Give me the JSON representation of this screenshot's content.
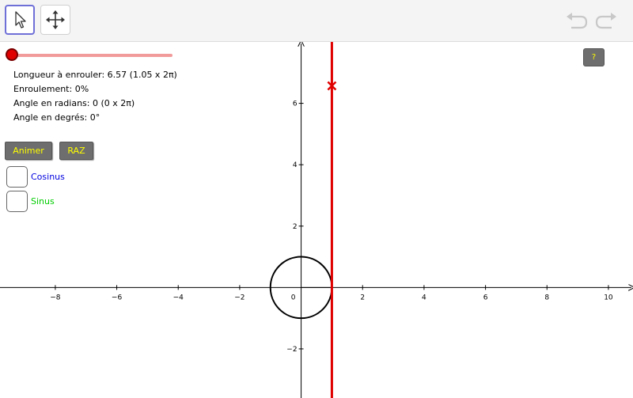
{
  "toolbar": {
    "tools": [
      {
        "name": "move",
        "icon": "pointer-arrow-icon",
        "active": true
      },
      {
        "name": "move-graphics-view",
        "icon": "four-arrow-move-icon",
        "active": false
      }
    ],
    "undo_icon": "undo-arrow-icon",
    "redo_icon": "redo-arrow-icon"
  },
  "slider": {
    "value_fraction": 0.0,
    "color": "#e00000",
    "track_color": "#f29b9b"
  },
  "info": {
    "longueur": "Longueur à enrouler: 6.57 (1.05 x 2π)",
    "enroulement": "Enroulement: 0%",
    "angle_radians": "Angle en radians: 0 (0 x 2π)",
    "angle_degres": "Angle en degrés: 0°"
  },
  "buttons": {
    "animer": "Animer",
    "raz": "RAZ",
    "help": "?"
  },
  "checkboxes": [
    {
      "label": "Cosinus",
      "color": "#0000e0",
      "checked": false
    },
    {
      "label": "Sinus",
      "color": "#00cc00",
      "checked": false
    }
  ],
  "graph": {
    "x_range": [
      -9.8,
      10.8
    ],
    "y_range": [
      -3.6,
      8
    ],
    "x_ticks": [
      "−8",
      "−6",
      "−4",
      "−2",
      "0",
      "2",
      "4",
      "6",
      "8",
      "10"
    ],
    "y_ticks": [
      "−2",
      "2",
      "4",
      "6"
    ],
    "circle": {
      "center_x": 0,
      "center_y": 0,
      "radius": 1
    },
    "vertical_line_x": 1,
    "point": {
      "x": 1,
      "y": 6.57
    },
    "line_color": "#e00000"
  }
}
